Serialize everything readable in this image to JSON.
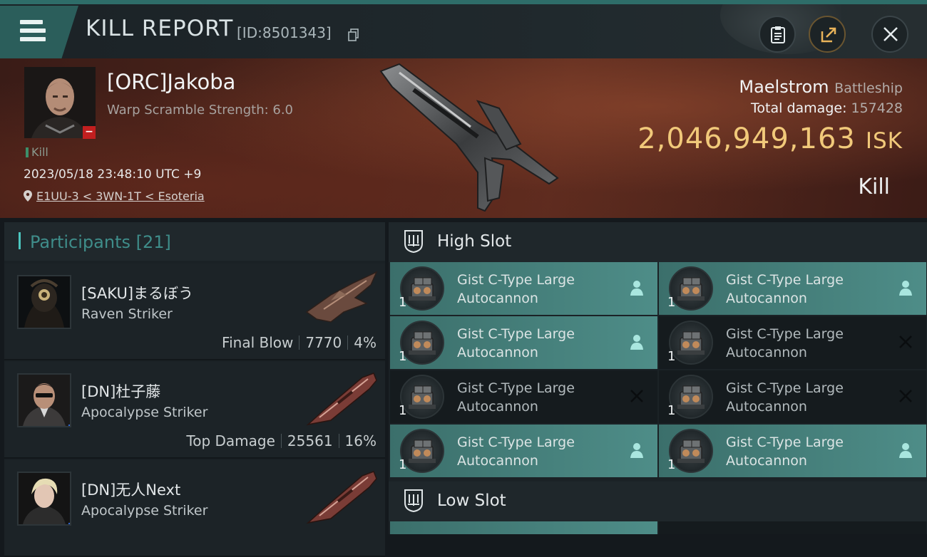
{
  "header": {
    "title": "KILL REPORT",
    "report_id": "[ID:8501343]",
    "buttons": [
      "clipboard",
      "share",
      "close"
    ]
  },
  "victim": {
    "name": "[ORC]Jakoba",
    "subtitle": "Warp Scramble Strength: 6.0",
    "tag": "Kill",
    "timestamp": "2023/05/18 23:48:10 UTC +9",
    "location": "E1UU-3 < 3WN-1T < Esoteria",
    "ship": "Maelstrom",
    "ship_class": "Battleship",
    "total_damage_label": "Total damage:",
    "total_damage": "157428",
    "isk_value": "2,046,949,163",
    "isk_unit": "ISK",
    "result": "Kill"
  },
  "participants": {
    "label": "Participants",
    "count": "[21]",
    "rows": [
      {
        "name": "[SAKU]まるぼう",
        "ship": "Raven Striker",
        "role": "Final Blow",
        "damage": "7770",
        "percent": "4%"
      },
      {
        "name": "[DN]杜子藤",
        "ship": "Apocalypse Striker",
        "role": "Top Damage",
        "damage": "25561",
        "percent": "16%"
      },
      {
        "name": "[DN]无人Next",
        "ship": "Apocalypse Striker",
        "role": "",
        "damage": "",
        "percent": ""
      }
    ]
  },
  "fittings": {
    "high_slot_label": "High Slot",
    "low_slot_label": "Low Slot",
    "high_slots": [
      {
        "line1": "Gist C-Type Large",
        "line2": "Autocannon",
        "qty": "1",
        "status": "dropped"
      },
      {
        "line1": "Gist C-Type Large",
        "line2": "Autocannon",
        "qty": "1",
        "status": "dropped"
      },
      {
        "line1": "Gist C-Type Large",
        "line2": "Autocannon",
        "qty": "1",
        "status": "dropped"
      },
      {
        "line1": "Gist C-Type Large",
        "line2": "Autocannon",
        "qty": "1",
        "status": "destroyed"
      },
      {
        "line1": "Gist C-Type Large",
        "line2": "Autocannon",
        "qty": "1",
        "status": "destroyed"
      },
      {
        "line1": "Gist C-Type Large",
        "line2": "Autocannon",
        "qty": "1",
        "status": "destroyed"
      },
      {
        "line1": "Gist C-Type Large",
        "line2": "Autocannon",
        "qty": "1",
        "status": "dropped"
      },
      {
        "line1": "Gist C-Type Large",
        "line2": "Autocannon",
        "qty": "1",
        "status": "dropped"
      }
    ]
  },
  "colors": {
    "accent": "#4cc6bf",
    "isk": "#f1c97a",
    "dropped_bg": "#4e8d88",
    "destroyed_bg": "#151b1e"
  }
}
